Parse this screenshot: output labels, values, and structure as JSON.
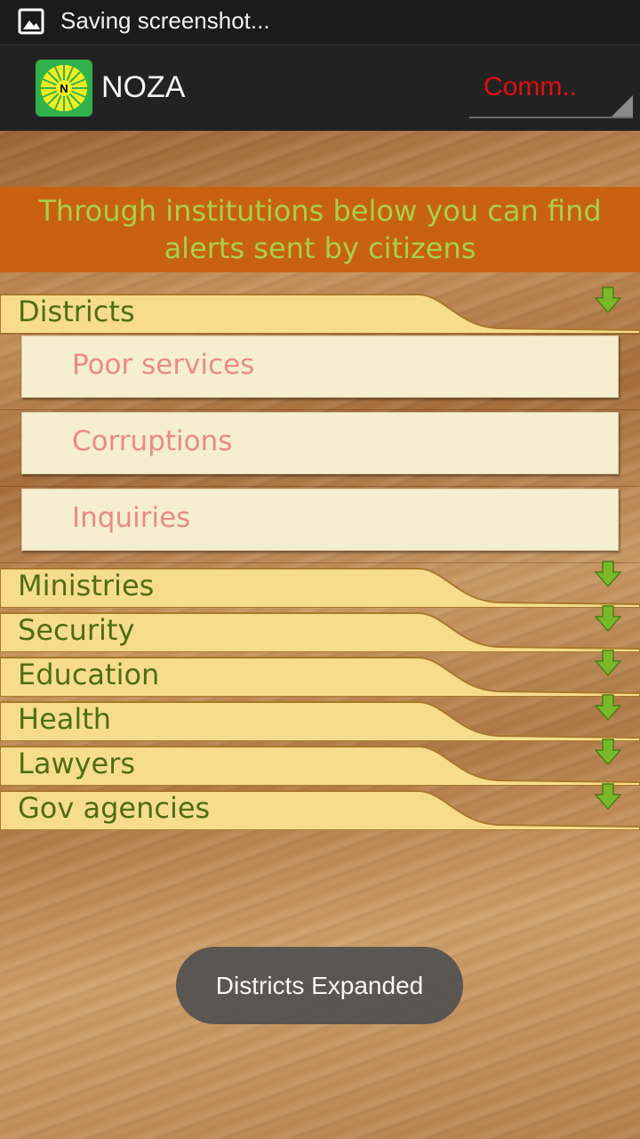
{
  "status_bar": {
    "notification_text": "Saving screenshot..."
  },
  "action_bar": {
    "title": "NOZA",
    "logo_letter": "N",
    "spinner_value": "Comm.."
  },
  "banner": {
    "text": "Through institutions below you can find alerts sent by citizens"
  },
  "groups": [
    {
      "label": "Districts",
      "expanded": true,
      "children": [
        "Poor services",
        "Corruptions",
        "Inquiries"
      ]
    },
    {
      "label": "Ministries",
      "expanded": false
    },
    {
      "label": "Security",
      "expanded": false
    },
    {
      "label": "Education",
      "expanded": false
    },
    {
      "label": "Health",
      "expanded": false
    },
    {
      "label": "Lawyers",
      "expanded": false
    },
    {
      "label": "Gov agencies",
      "expanded": false
    }
  ],
  "toast": {
    "text": "Districts Expanded"
  },
  "colors": {
    "banner_bg": "#c9620f",
    "banner_text": "#a8d04a",
    "group_text": "#4e6e14",
    "child_text": "#ec8a83",
    "spinner_text": "#e10e0e",
    "expand_arrow": "#7ab82a"
  },
  "icons": {
    "status_bar": "image-icon",
    "expand_arrow": "arrow-down-icon",
    "spinner_caret": "dropdown-caret-icon"
  }
}
